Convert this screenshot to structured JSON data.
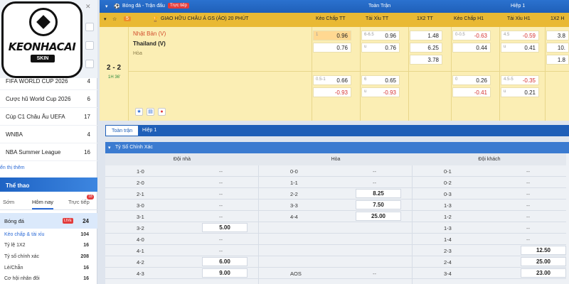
{
  "sidebar": {
    "logo_text": "KEONHACAI",
    "logo_sub": "SKIN",
    "leagues": [
      {
        "name": "FIFA WORLD CUP 2026",
        "count": "4"
      },
      {
        "name": "Cược hũ World Cup 2026",
        "count": "6"
      },
      {
        "name": "Cúp C1 Châu Âu UEFA",
        "count": "17"
      },
      {
        "name": "WNBA",
        "count": "4"
      },
      {
        "name": "NBA Summer League",
        "count": "16"
      }
    ],
    "more_link": "ển thị thêm",
    "sport_header": "Thể thao",
    "tabs": [
      "Sớm",
      "Hôm nay",
      "Trực tiếp"
    ],
    "live_badge": "18",
    "sport": {
      "name": "Bóng đá",
      "live": "LIVE",
      "count": "24"
    },
    "sub_items": [
      {
        "name": "Kèo chấp & tài xỉu",
        "count": "104"
      },
      {
        "name": "Tỷ lệ 1X2",
        "count": "16"
      },
      {
        "name": "Tỷ số chính xác",
        "count": "208"
      },
      {
        "name": "Lẻ/Chẵn",
        "count": "16"
      },
      {
        "name": "Cơ hội nhân đôi",
        "count": "16"
      }
    ]
  },
  "topbar": {
    "title": "Bóng đá - Trận đấu",
    "live": "Trực tiếp",
    "col_full": "Toàn Trận",
    "col_half": "Hiệp 1"
  },
  "league_bar": {
    "league": "GIAO HỮU CHÂU Á GS (ẢO) 20 PHÚT",
    "h1": "Kèo Chấp TT",
    "h2": "Tài Xỉu TT",
    "h3": "1X2 TT",
    "h4": "Kèo Chấp H1",
    "h5": "Tài Xỉu H1",
    "h6": "1X2 H"
  },
  "match": {
    "team1": "Nhật Bản (V)",
    "team2": "Thailand (V)",
    "draw": "Hòa",
    "score": "2 - 2",
    "time": "1H 36'",
    "odds": {
      "hc_tt_line": "1",
      "hc_tt_1": "0.96",
      "hc_tt_2": "0.76",
      "ou_tt_line": "6-6.5",
      "ou_tt_u": "u",
      "ou_tt_1": "0.96",
      "ou_tt_2": "0.76",
      "x_tt_1": "1.48",
      "x_tt_2": "6.25",
      "x_tt_3": "3.78",
      "hc_h1_line": "0-0.5",
      "hc_h1_1": "-0.63",
      "hc_h1_2": "0.44",
      "ou_h1_line": "4.5",
      "ou_h1_u": "u",
      "ou_h1_1": "-0.59",
      "ou_h1_2": "0.41",
      "x_h1_1": "3.8",
      "x_h1_2": "10.",
      "x_h1_3": "1.8",
      "r2_hc_tt_line": "0.5-1",
      "r2_hc_tt_1": "0.66",
      "r2_hc_tt_2": "-0.93",
      "r2_ou_tt_line": "6",
      "r2_ou_tt_u": "u",
      "r2_ou_tt_1": "0.65",
      "r2_ou_tt_2": "-0.93",
      "r2_hc_h1_line": "0",
      "r2_hc_h1_1": "0.26",
      "r2_hc_h1_2": "-0.41",
      "r2_ou_h1_line": "4.5-5",
      "r2_ou_h1_u": "u",
      "r2_ou_h1_1": "-0.35",
      "r2_ou_h1_2": "0.21"
    }
  },
  "section": {
    "tabs": [
      "Toàn trận",
      "Hiệp 1"
    ],
    "title": "Tỷ Số Chính Xác"
  },
  "table": {
    "headers": [
      "Đội nhà",
      "Hòa",
      "Đội khách"
    ],
    "home": [
      {
        "s": "1-0",
        "o": "--"
      },
      {
        "s": "2-0",
        "o": "--"
      },
      {
        "s": "2-1",
        "o": "--"
      },
      {
        "s": "3-0",
        "o": "--"
      },
      {
        "s": "3-1",
        "o": "--"
      },
      {
        "s": "3-2",
        "o": "5.00"
      },
      {
        "s": "4-0",
        "o": "--"
      },
      {
        "s": "4-1",
        "o": "--"
      },
      {
        "s": "4-2",
        "o": "6.00"
      },
      {
        "s": "4-3",
        "o": "9.00"
      }
    ],
    "draw": [
      {
        "s": "0-0",
        "o": "--"
      },
      {
        "s": "1-1",
        "o": "--"
      },
      {
        "s": "2-2",
        "o": "8.25"
      },
      {
        "s": "3-3",
        "o": "7.50"
      },
      {
        "s": "4-4",
        "o": "25.00"
      },
      {
        "s": "",
        "o": ""
      },
      {
        "s": "",
        "o": ""
      },
      {
        "s": "",
        "o": ""
      },
      {
        "s": "",
        "o": ""
      },
      {
        "s": "AOS",
        "o": "--"
      }
    ],
    "away": [
      {
        "s": "0-1",
        "o": "--"
      },
      {
        "s": "0-2",
        "o": "--"
      },
      {
        "s": "0-3",
        "o": "--"
      },
      {
        "s": "1-3",
        "o": "--"
      },
      {
        "s": "1-2",
        "o": "--"
      },
      {
        "s": "1-3",
        "o": "--"
      },
      {
        "s": "1-4",
        "o": "--"
      },
      {
        "s": "2-3",
        "o": "12.50"
      },
      {
        "s": "2-4",
        "o": "25.00"
      },
      {
        "s": "3-4",
        "o": "23.00"
      }
    ]
  }
}
